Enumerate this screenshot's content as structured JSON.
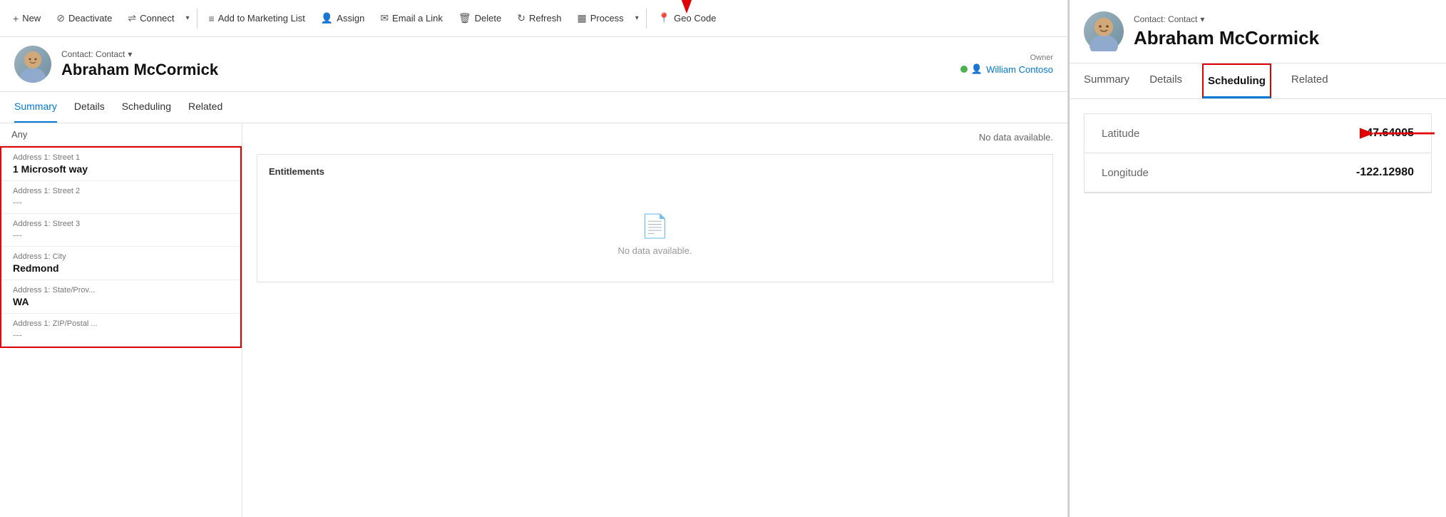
{
  "toolbar": {
    "new_label": "New",
    "deactivate_label": "Deactivate",
    "connect_label": "Connect",
    "add_to_marketing_list_label": "Add to Marketing List",
    "assign_label": "Assign",
    "email_a_link_label": "Email a Link",
    "delete_label": "Delete",
    "refresh_label": "Refresh",
    "process_label": "Process",
    "geo_code_label": "Geo Code"
  },
  "left_record": {
    "type": "Contact: Contact",
    "name": "Abraham McCormick",
    "owner_label": "Owner",
    "owner_name": "William Contoso"
  },
  "left_tabs": [
    {
      "label": "Summary",
      "active": true
    },
    {
      "label": "Details",
      "active": false
    },
    {
      "label": "Scheduling",
      "active": false
    },
    {
      "label": "Related",
      "active": false
    }
  ],
  "form_section": {
    "section_label": "Any",
    "fields": [
      {
        "label": "Address 1: Street 1",
        "value": "1 Microsoft way",
        "bold": true,
        "empty": false
      },
      {
        "label": "Address 1: Street 2",
        "value": "---",
        "bold": false,
        "empty": true
      },
      {
        "label": "Address 1: Street 3",
        "value": "---",
        "bold": false,
        "empty": true
      },
      {
        "label": "Address 1: City",
        "value": "Redmond",
        "bold": true,
        "empty": false
      },
      {
        "label": "Address 1: State/Prov...",
        "value": "WA",
        "bold": true,
        "empty": false
      },
      {
        "label": "Address 1: ZIP/Postal ...",
        "value": "---",
        "bold": false,
        "empty": true
      }
    ]
  },
  "entitlements": {
    "no_data_top": "No data available.",
    "title": "Entitlements",
    "no_data_center": "No data available."
  },
  "right_record": {
    "type": "Contact: Contact",
    "name": "Abraham McCormick"
  },
  "right_tabs": [
    {
      "label": "Summary",
      "active": false
    },
    {
      "label": "Details",
      "active": false
    },
    {
      "label": "Scheduling",
      "active": true
    },
    {
      "label": "Related",
      "active": false
    }
  ],
  "geo": {
    "latitude_label": "Latitude",
    "latitude_value": "47.64005",
    "longitude_label": "Longitude",
    "longitude_value": "-122.12980"
  },
  "icons": {
    "plus": "+",
    "deactivate": "🔕",
    "connect": "👤",
    "marketing": "≡",
    "assign": "👤",
    "email": "✉",
    "delete": "🗑",
    "refresh": "↻",
    "process": "▦",
    "geo": "📍",
    "chevron_down": "⌄",
    "document_empty": "📄"
  }
}
